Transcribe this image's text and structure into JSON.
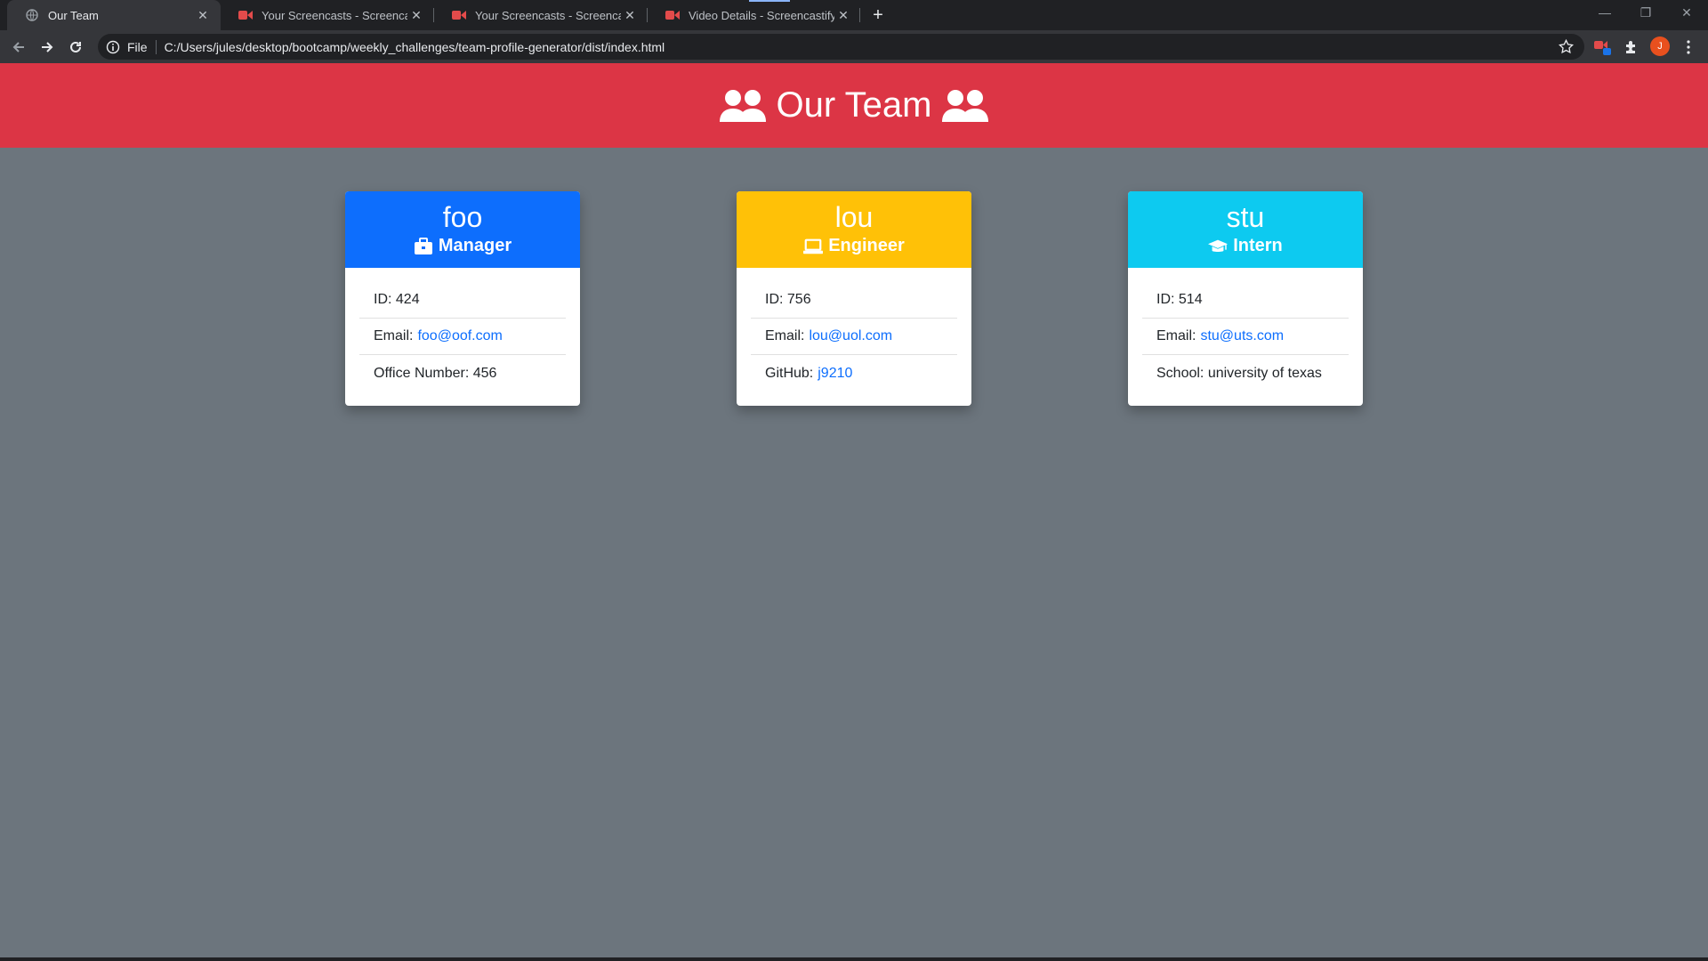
{
  "browser": {
    "tabs": [
      {
        "title": "Our Team",
        "active": true,
        "favicon": "globe-icon"
      },
      {
        "title": "Your Screencasts - Screencastify",
        "active": false,
        "favicon": "screencastify-icon"
      },
      {
        "title": "Your Screencasts - Screencastify",
        "active": false,
        "favicon": "screencastify-icon"
      },
      {
        "title": "Video Details - Screencastify",
        "active": false,
        "favicon": "screencastify-icon"
      }
    ],
    "address": {
      "scheme_label": "File",
      "url": "C:/Users/jules/desktop/bootcamp/weekly_challenges/team-profile-generator/dist/index.html"
    },
    "profile_initial": "J",
    "extension_badge": "1"
  },
  "header": {
    "title": "Our Team",
    "icon": "users-icon",
    "color": "#dc3545"
  },
  "team": [
    {
      "name": "foo",
      "role": "Manager",
      "role_icon": "briefcase-icon",
      "color": "#0d6efd",
      "id_label": "ID: ",
      "id": "424",
      "email_label": "Email:",
      "email": "foo@oof.com",
      "extra_label": "Office Number: ",
      "extra_value": "456"
    },
    {
      "name": "lou",
      "role": "Engineer",
      "role_icon": "laptop-icon",
      "color": "#ffc107",
      "id_label": "ID: ",
      "id": "756",
      "email_label": "Email:",
      "email": "lou@uol.com",
      "extra_label": "GitHub:",
      "extra_value": "j9210"
    },
    {
      "name": "stu",
      "role": "Intern",
      "role_icon": "graduation-cap-icon",
      "color": "#0dcaf0",
      "id_label": "ID: ",
      "id": "514",
      "email_label": "Email:",
      "email": "stu@uts.com",
      "extra_label": "School: ",
      "extra_value": "university of texas"
    }
  ]
}
